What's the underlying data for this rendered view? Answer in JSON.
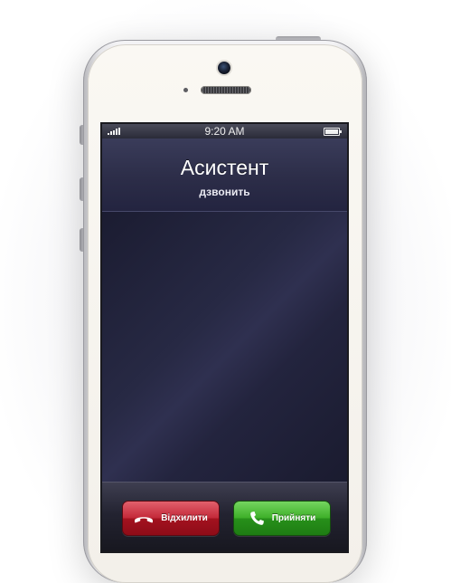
{
  "status_bar": {
    "time": "9:20 AM",
    "signal_icon": "signal-bars-icon",
    "battery_icon": "battery-icon"
  },
  "call": {
    "caller_name": "Асистент",
    "status": "дзвонить"
  },
  "actions": {
    "decline": {
      "label": "Відхилити",
      "icon": "phone-hangup-icon",
      "color": "#c42a3a"
    },
    "accept": {
      "label": "Прийняти",
      "icon": "phone-icon",
      "color": "#3fb02a"
    }
  },
  "colors": {
    "screen_background": "#1b1c32",
    "phone_body": "#f3f0ea"
  }
}
